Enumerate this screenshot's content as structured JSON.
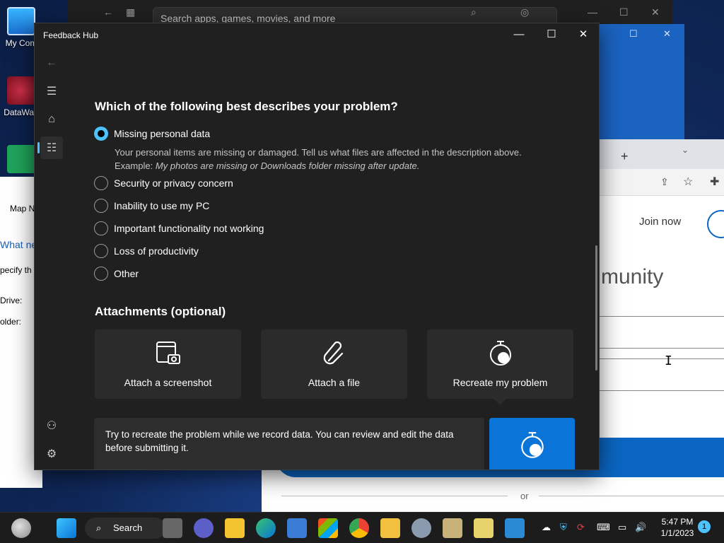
{
  "desktop": {
    "icons": [
      {
        "label": "My Com"
      },
      {
        "label": "DataWag"
      },
      {
        "label": ""
      }
    ]
  },
  "store": {
    "search_placeholder": "Search apps, games, movies, and more"
  },
  "left_window": {
    "lines": [
      "Map N",
      "What ne",
      "pecify th",
      "Drive:",
      "older:"
    ]
  },
  "browser": {
    "new_tab": "+",
    "join_now": "Join now",
    "community_fragment": "munity",
    "or_text": "or"
  },
  "feedback_hub": {
    "title": "Feedback Hub",
    "question": "Which of the following best describes your problem?",
    "options": [
      {
        "label": "Missing personal data",
        "checked": true
      },
      {
        "label": "Security or privacy concern",
        "checked": false
      },
      {
        "label": "Inability to use my PC",
        "checked": false
      },
      {
        "label": "Important functionality not working",
        "checked": false
      },
      {
        "label": "Loss of productivity",
        "checked": false
      },
      {
        "label": "Other",
        "checked": false
      }
    ],
    "selected_description": "Your personal items are missing or damaged. Tell us what files are affected in the description above.",
    "example_prefix": "Example:",
    "example_text": "My photos are missing or Downloads folder missing after update.",
    "attachments_heading": "Attachments (optional)",
    "attachments": [
      {
        "label": "Attach a screenshot",
        "icon": "screenshot-icon"
      },
      {
        "label": "Attach a file",
        "icon": "paperclip-icon"
      },
      {
        "label": "Recreate my problem",
        "icon": "stopwatch-icon"
      }
    ],
    "recreate_text": "Try to recreate the problem while we record data. You can review and edit the data before submitting it."
  },
  "taskbar": {
    "search_label": "Search",
    "time": "5:47 PM",
    "date": "1/1/2023",
    "notification_count": "1"
  },
  "colors": {
    "accent": "#4cc2ff",
    "start_recording": "#0a74d8",
    "window_bg": "#202020",
    "card_bg": "#2b2b2b"
  }
}
